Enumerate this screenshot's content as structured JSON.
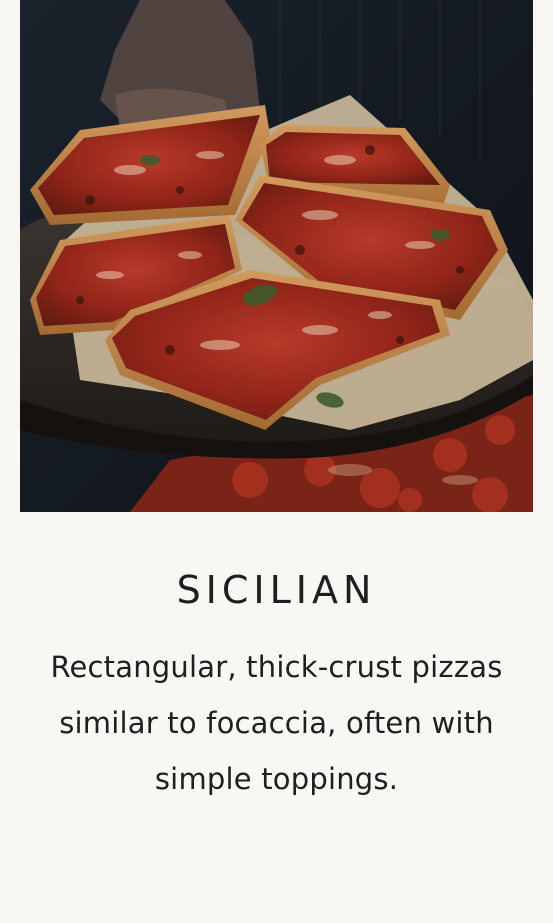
{
  "card": {
    "image_alt": "Sicilian pizza squares on a wooden board",
    "title": "SICILIAN",
    "description": "Rectangular, thick-crust pizzas similar to focaccia, often with simple toppings."
  }
}
